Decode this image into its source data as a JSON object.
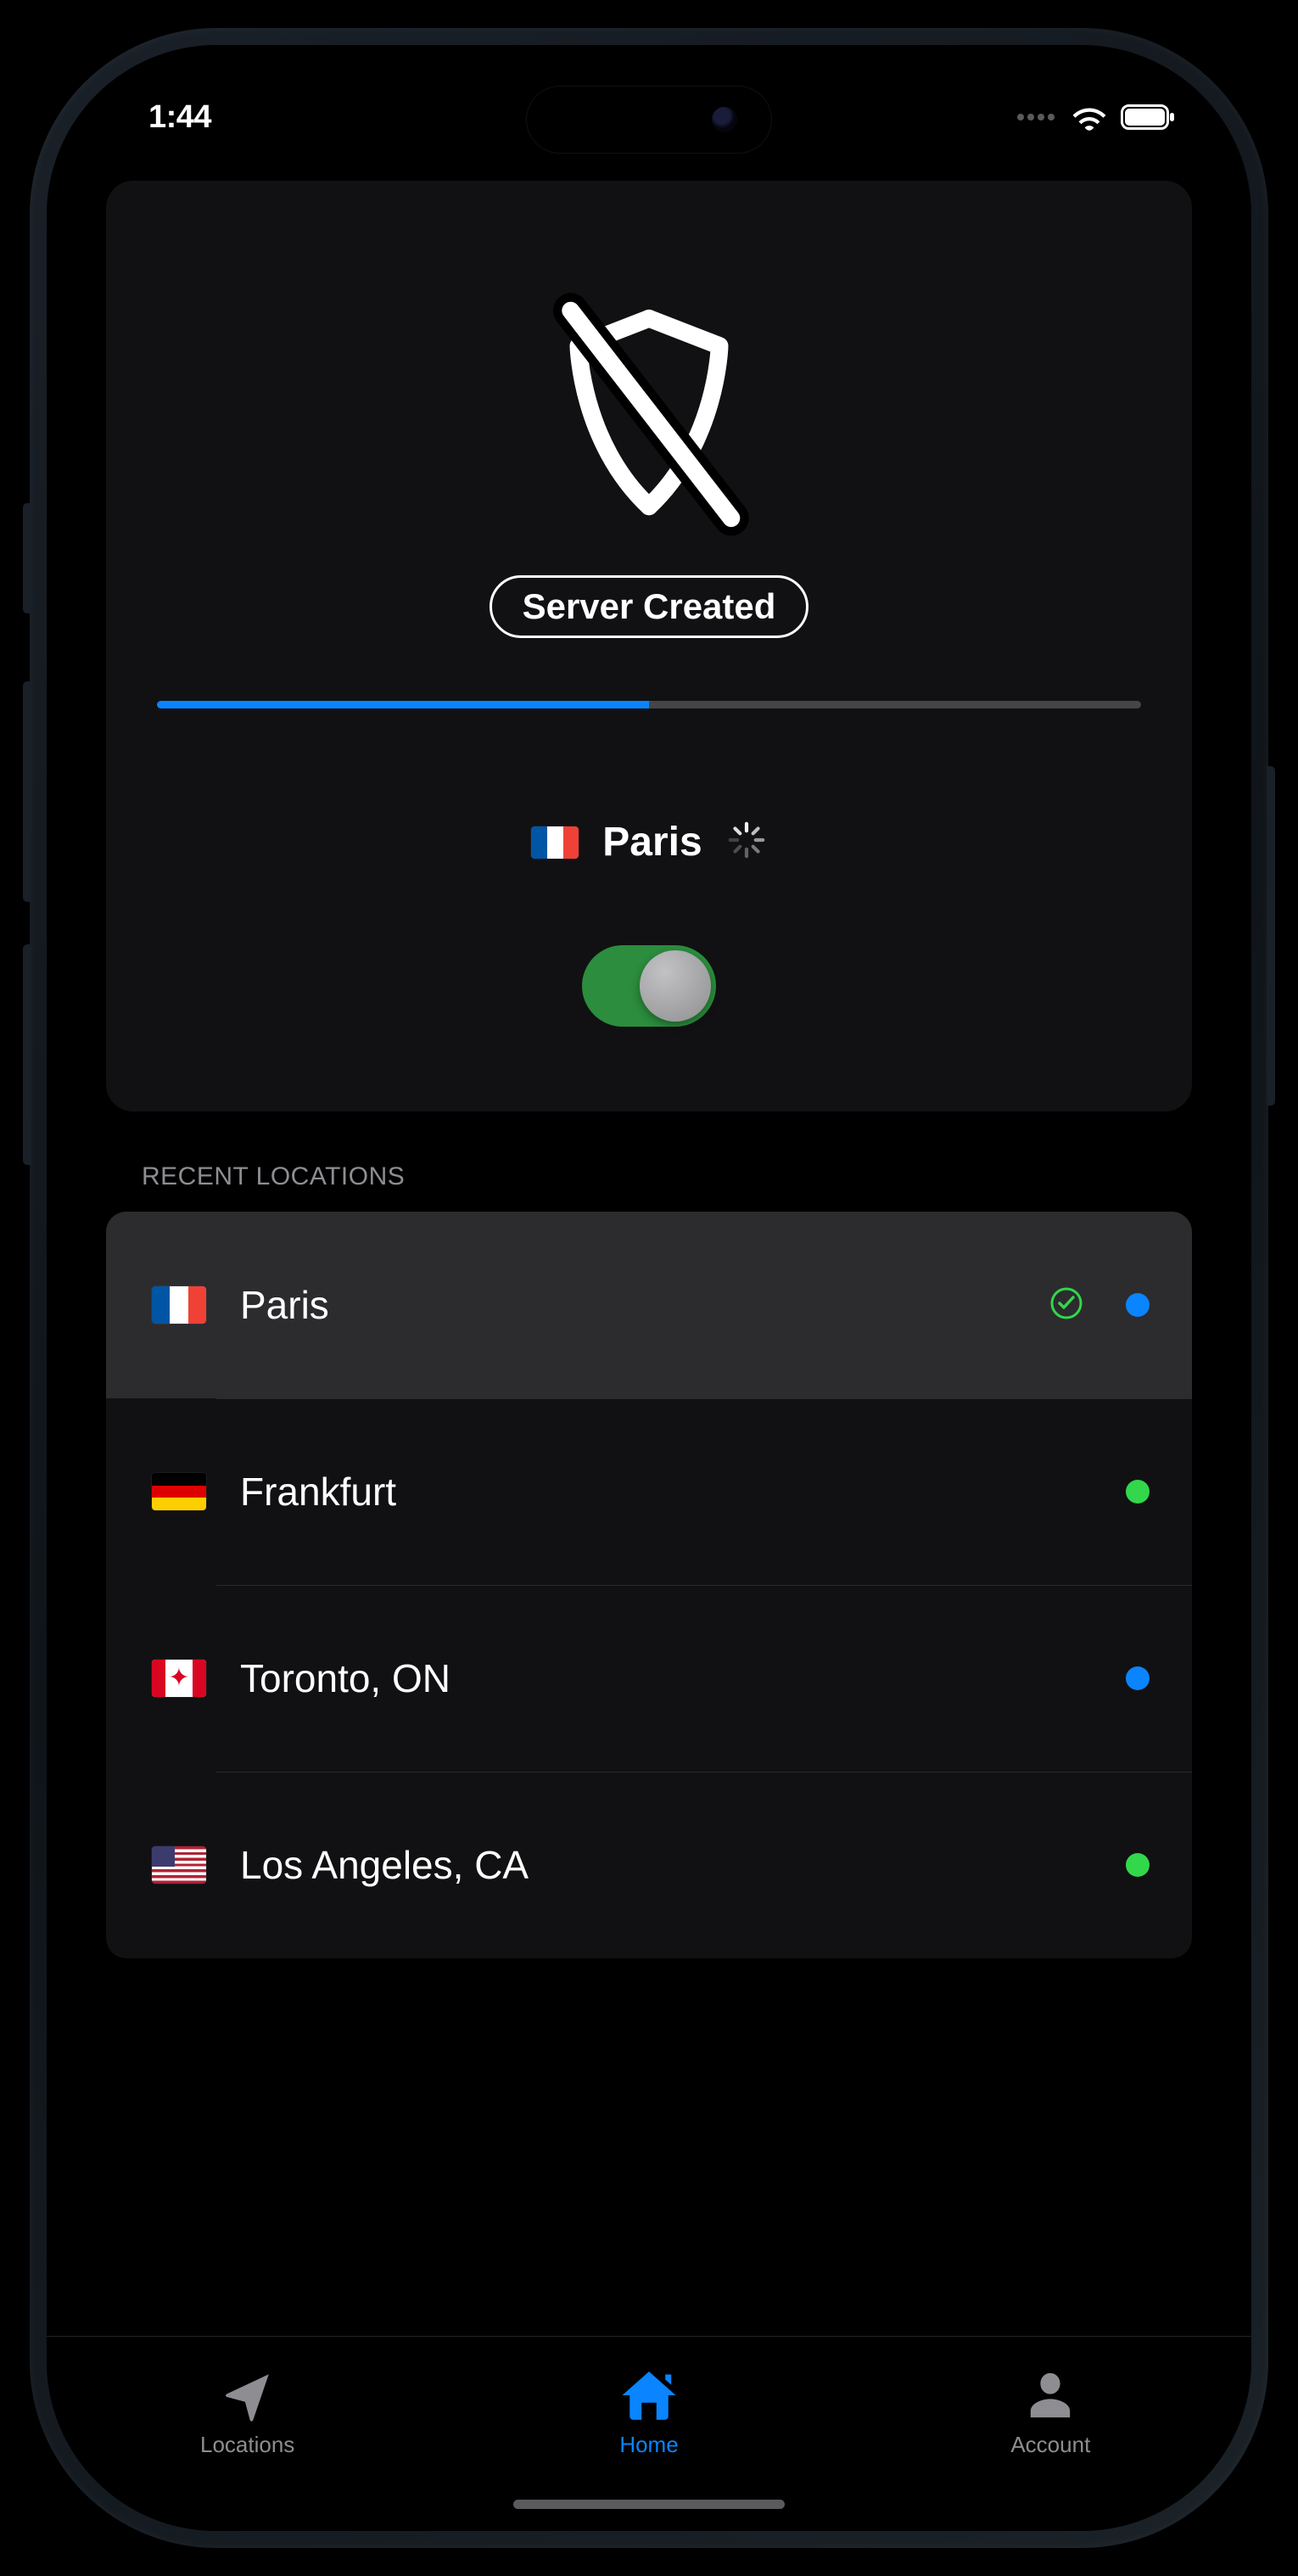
{
  "status_bar": {
    "time": "1:44"
  },
  "status_card": {
    "label": "Server Created",
    "progress_percent": 50,
    "location": {
      "name": "Paris",
      "flag": "fr"
    },
    "toggle_on": true
  },
  "recent": {
    "header": "RECENT LOCATIONS",
    "items": [
      {
        "name": "Paris",
        "flag": "fr",
        "selected": true,
        "status_dot": "blue"
      },
      {
        "name": "Frankfurt",
        "flag": "de",
        "selected": false,
        "status_dot": "green"
      },
      {
        "name": "Toronto, ON",
        "flag": "ca",
        "selected": false,
        "status_dot": "blue"
      },
      {
        "name": "Los Angeles, CA",
        "flag": "us",
        "selected": false,
        "status_dot": "green"
      }
    ]
  },
  "tabs": {
    "locations": "Locations",
    "home": "Home",
    "account": "Account",
    "active": "home"
  },
  "colors": {
    "accent": "#0a84ff",
    "green": "#32d74b",
    "card": "#111113",
    "selected_row": "#2c2c2e"
  }
}
